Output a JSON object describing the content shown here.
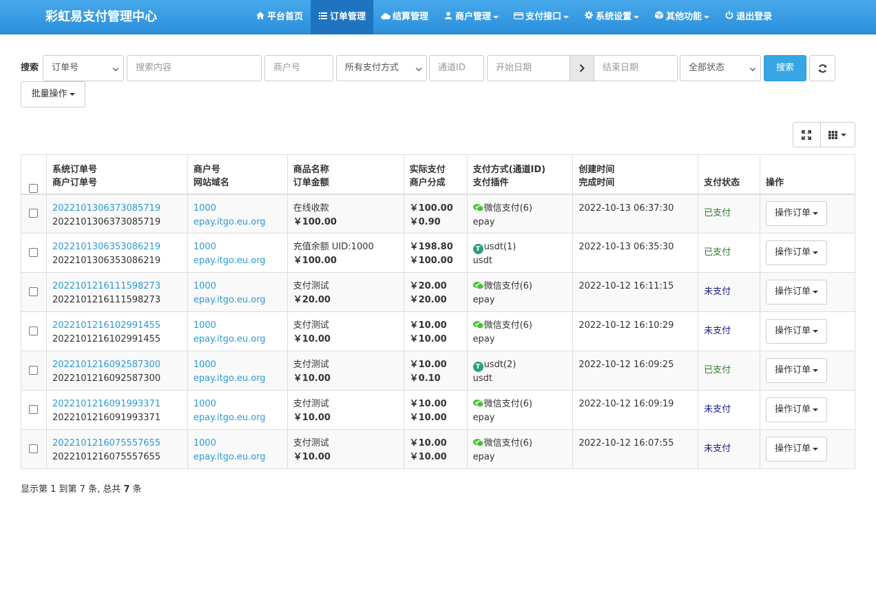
{
  "navbar": {
    "brand": "彩虹易支付管理中心",
    "items": [
      {
        "label": "平台首页",
        "icon": "home-icon",
        "active": false,
        "dropdown": false
      },
      {
        "label": "订单管理",
        "icon": "list-icon",
        "active": true,
        "dropdown": false
      },
      {
        "label": "结算管理",
        "icon": "cloud-icon",
        "active": false,
        "dropdown": false
      },
      {
        "label": "商户管理",
        "icon": "user-icon",
        "active": false,
        "dropdown": true
      },
      {
        "label": "支付接口",
        "icon": "credit-card-icon",
        "active": false,
        "dropdown": true
      },
      {
        "label": "系统设置",
        "icon": "gear-icon",
        "active": false,
        "dropdown": true
      },
      {
        "label": "其他功能",
        "icon": "cube-icon",
        "active": false,
        "dropdown": true
      },
      {
        "label": "退出登录",
        "icon": "power-icon",
        "active": false,
        "dropdown": false
      }
    ]
  },
  "search": {
    "label": "搜索",
    "field_select": "订单号",
    "content_placeholder": "搜索内容",
    "merchant_placeholder": "商户号",
    "paytype_select": "所有支付方式",
    "channel_placeholder": "通道ID",
    "start_placeholder": "开始日期",
    "end_placeholder": "结束日期",
    "status_select": "全部状态",
    "search_button": "搜索",
    "batch_button": "批量操作"
  },
  "table": {
    "headers": [
      [
        "系统订单号",
        "商户订单号"
      ],
      [
        "商户号",
        "网站域名"
      ],
      [
        "商品名称",
        "订单金额"
      ],
      [
        "实际支付",
        "商户分成"
      ],
      [
        "支付方式(通道ID)",
        "支付插件"
      ],
      [
        "创建时间",
        "完成时间"
      ],
      [
        "支付状态",
        ""
      ],
      [
        "操作",
        ""
      ]
    ],
    "rows": [
      {
        "trade_no": "2022101306373085719",
        "out_trade_no": "2022101306373085719",
        "uid": "1000",
        "domain": "epay.itgo.eu.org",
        "name": "在线收款",
        "money": "￥100.00",
        "realmoney": "￥100.00",
        "getmoney": "￥0.90",
        "paytype": "微信支付(6)",
        "paytype_kind": "wxpay",
        "plugin": "epay",
        "addtime": "2022-10-13 06:37:30",
        "endtime": "",
        "status": "已支付",
        "paid": true,
        "op": "操作订单"
      },
      {
        "trade_no": "2022101306353086219",
        "out_trade_no": "2022101306353086219",
        "uid": "1000",
        "domain": "epay.itgo.eu.org",
        "name": "充值余额 UID:1000",
        "money": "￥100.00",
        "realmoney": "￥198.80",
        "getmoney": "￥100.00",
        "paytype": "usdt(1)",
        "paytype_kind": "usdt",
        "plugin": "usdt",
        "addtime": "2022-10-13 06:35:30",
        "endtime": "",
        "status": "已支付",
        "paid": true,
        "op": "操作订单"
      },
      {
        "trade_no": "2022101216111598273",
        "out_trade_no": "2022101216111598273",
        "uid": "1000",
        "domain": "epay.itgo.eu.org",
        "name": "支付测试",
        "money": "￥20.00",
        "realmoney": "￥20.00",
        "getmoney": "￥20.00",
        "paytype": "微信支付(6)",
        "paytype_kind": "wxpay",
        "plugin": "epay",
        "addtime": "2022-10-12 16:11:15",
        "endtime": "",
        "status": "未支付",
        "paid": false,
        "op": "操作订单"
      },
      {
        "trade_no": "2022101216102991455",
        "out_trade_no": "2022101216102991455",
        "uid": "1000",
        "domain": "epay.itgo.eu.org",
        "name": "支付测试",
        "money": "￥10.00",
        "realmoney": "￥10.00",
        "getmoney": "￥10.00",
        "paytype": "微信支付(6)",
        "paytype_kind": "wxpay",
        "plugin": "epay",
        "addtime": "2022-10-12 16:10:29",
        "endtime": "",
        "status": "未支付",
        "paid": false,
        "op": "操作订单"
      },
      {
        "trade_no": "2022101216092587300",
        "out_trade_no": "2022101216092587300",
        "uid": "1000",
        "domain": "epay.itgo.eu.org",
        "name": "支付测试",
        "money": "￥10.00",
        "realmoney": "￥10.00",
        "getmoney": "￥0.10",
        "paytype": "usdt(2)",
        "paytype_kind": "usdt",
        "plugin": "usdt",
        "addtime": "2022-10-12 16:09:25",
        "endtime": "",
        "status": "已支付",
        "paid": true,
        "op": "操作订单"
      },
      {
        "trade_no": "2022101216091993371",
        "out_trade_no": "2022101216091993371",
        "uid": "1000",
        "domain": "epay.itgo.eu.org",
        "name": "支付测试",
        "money": "￥10.00",
        "realmoney": "￥10.00",
        "getmoney": "￥10.00",
        "paytype": "微信支付(6)",
        "paytype_kind": "wxpay",
        "plugin": "epay",
        "addtime": "2022-10-12 16:09:19",
        "endtime": "",
        "status": "未支付",
        "paid": false,
        "op": "操作订单"
      },
      {
        "trade_no": "2022101216075557655",
        "out_trade_no": "2022101216075557655",
        "uid": "1000",
        "domain": "epay.itgo.eu.org",
        "name": "支付测试",
        "money": "￥10.00",
        "realmoney": "￥10.00",
        "getmoney": "￥10.00",
        "paytype": "微信支付(6)",
        "paytype_kind": "wxpay",
        "plugin": "epay",
        "addtime": "2022-10-12 16:07:55",
        "endtime": "",
        "status": "未支付",
        "paid": false,
        "op": "操作订单"
      }
    ]
  },
  "pagination": {
    "prefix": "显示第 1 到第 7 条, 总共 ",
    "total": "7",
    "suffix": " 条"
  },
  "colors": {
    "nav_bg": "#2a8fdd",
    "nav_active": "#1e74c0",
    "link": "#2a9ad6",
    "primary_button": "#36a6e4",
    "paid": "#2a7a2a",
    "unpaid": "#1a1a8a",
    "wechat_green": "#4cbf3a",
    "usdt_green": "#26a17b"
  }
}
